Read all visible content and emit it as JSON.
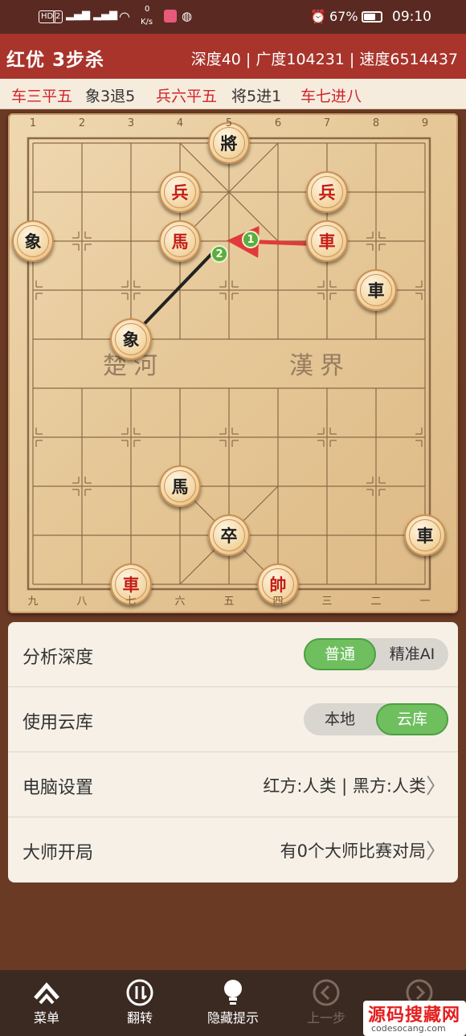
{
  "status_bar": {
    "hd_badge": "HD",
    "sim_badge": "2",
    "net_speed_value": "0",
    "net_speed_unit": "K/s",
    "battery": "67%",
    "time": "09:10"
  },
  "header": {
    "title": "红优 3步杀",
    "stats": "深度40 | 广度104231 | 速度6514437"
  },
  "moves": [
    {
      "text": "车三平五",
      "side": "red"
    },
    {
      "text": "象3退5",
      "side": "black"
    },
    {
      "text": "兵六平五",
      "side": "red"
    },
    {
      "text": "将5进1",
      "side": "black"
    },
    {
      "text": "车七进八",
      "side": "red"
    }
  ],
  "board": {
    "top_coords": [
      "1",
      "2",
      "3",
      "4",
      "5",
      "6",
      "7",
      "8",
      "9"
    ],
    "bottom_coords": [
      "九",
      "八",
      "七",
      "六",
      "五",
      "四",
      "三",
      "二",
      "一"
    ],
    "river_left": "楚河",
    "river_right": "漢界",
    "pieces": [
      {
        "char": "將",
        "side": "black",
        "file": 4,
        "rank": 0
      },
      {
        "char": "兵",
        "side": "red",
        "file": 3,
        "rank": 1
      },
      {
        "char": "兵",
        "side": "red",
        "file": 6,
        "rank": 1
      },
      {
        "char": "象",
        "side": "black",
        "file": 0,
        "rank": 2
      },
      {
        "char": "馬",
        "side": "red",
        "file": 3,
        "rank": 2
      },
      {
        "char": "車",
        "side": "red",
        "file": 6,
        "rank": 2
      },
      {
        "char": "車",
        "side": "black",
        "file": 7,
        "rank": 3
      },
      {
        "char": "象",
        "side": "black",
        "file": 2,
        "rank": 4
      },
      {
        "char": "馬",
        "side": "black",
        "file": 3,
        "rank": 7
      },
      {
        "char": "卒",
        "side": "black",
        "file": 4,
        "rank": 8
      },
      {
        "char": "車",
        "side": "black",
        "file": 8,
        "rank": 8
      },
      {
        "char": "車",
        "side": "red",
        "file": 2,
        "rank": 9
      },
      {
        "char": "帥",
        "side": "red",
        "file": 5,
        "rank": 9
      }
    ],
    "hint_markers": [
      "1",
      "2"
    ],
    "hint_colors": {
      "arrow1": "#e03a3a",
      "arrow2": "#222222",
      "marker": "#5cae3a"
    }
  },
  "panel": {
    "analysis_depth": {
      "label": "分析深度",
      "options": [
        "普通",
        "精准AI"
      ],
      "selected": 0
    },
    "cloud": {
      "label": "使用云库",
      "options": [
        "本地",
        "云库"
      ],
      "selected": 1
    },
    "computer": {
      "label": "电脑设置",
      "value": "红方:人类 | 黑方:人类"
    },
    "master": {
      "label": "大师开局",
      "value": "有0个大师比赛对局"
    }
  },
  "nav": {
    "menu": "菜单",
    "flip": "翻转",
    "hint": "隐藏提示",
    "prev": "上一步",
    "watermark_main": "源码搜藏网",
    "watermark_sub": "codesocang.com"
  },
  "colors": {
    "header": "#a9342b",
    "accent_green": "#6fbf5f",
    "red_text": "#d2232a"
  }
}
